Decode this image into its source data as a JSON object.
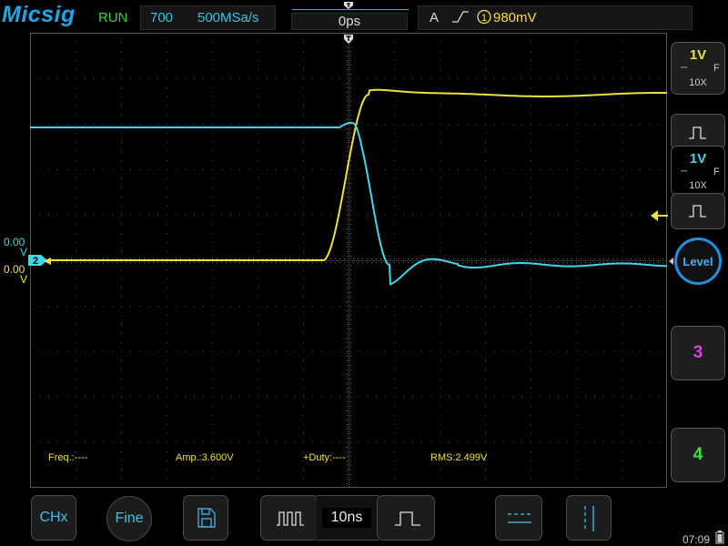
{
  "brand": "Micsig",
  "status": "RUN",
  "acquisition": {
    "memory": "700",
    "sample_rate": "500MSa/s"
  },
  "horizontal": {
    "position": "0ps",
    "timebase": "10ns"
  },
  "trigger": {
    "mode": "A",
    "source": "1",
    "level": "980mV"
  },
  "channels": {
    "ch1": {
      "scale": "1V",
      "probe": "10X",
      "coupling": "F",
      "offset": "0.00",
      "unit": "V",
      "color": "#f0e040"
    },
    "ch2": {
      "scale": "1V",
      "probe": "10X",
      "coupling": "F",
      "offset": "0.00",
      "unit": "V",
      "marker": "2",
      "color": "#3fd8e8"
    }
  },
  "measurements": {
    "freq": "Freq.:----",
    "amp": "Amp.:3.600V",
    "duty": "+Duty:----",
    "rms": "RMS:2.499V"
  },
  "right_panel": {
    "level_label": "Level",
    "ch3_label": "3",
    "ch4_label": "4"
  },
  "bottom_bar": {
    "chx_label": "CHx",
    "fine_label": "Fine"
  },
  "clock": "07:09",
  "colors": {
    "ch1": "#f0e040",
    "ch2": "#3fd8e8",
    "ch3": "#e040e0",
    "ch4": "#40e040",
    "accent": "#1ea7e8"
  }
}
